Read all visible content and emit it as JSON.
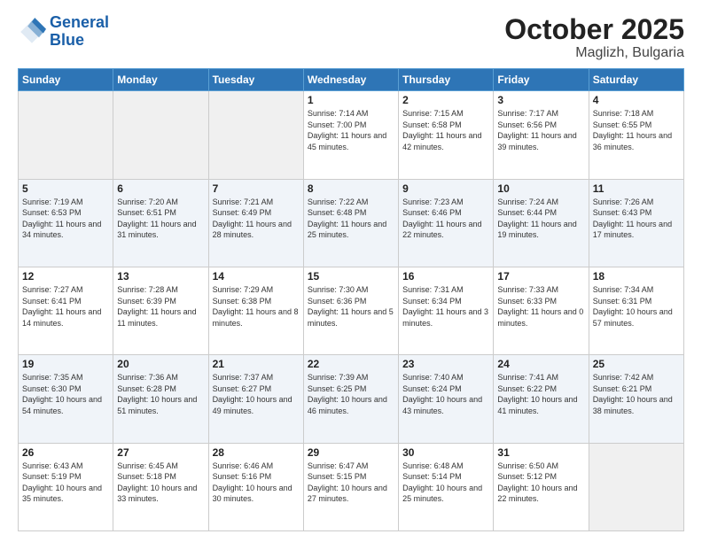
{
  "header": {
    "logo_general": "General",
    "logo_blue": "Blue",
    "month_title": "October 2025",
    "location": "Maglizh, Bulgaria"
  },
  "weekdays": [
    "Sunday",
    "Monday",
    "Tuesday",
    "Wednesday",
    "Thursday",
    "Friday",
    "Saturday"
  ],
  "weeks": [
    [
      {
        "day": "",
        "empty": true
      },
      {
        "day": "",
        "empty": true
      },
      {
        "day": "",
        "empty": true
      },
      {
        "day": "1",
        "sunrise": "7:14 AM",
        "sunset": "7:00 PM",
        "daylight": "11 hours and 45 minutes."
      },
      {
        "day": "2",
        "sunrise": "7:15 AM",
        "sunset": "6:58 PM",
        "daylight": "11 hours and 42 minutes."
      },
      {
        "day": "3",
        "sunrise": "7:17 AM",
        "sunset": "6:56 PM",
        "daylight": "11 hours and 39 minutes."
      },
      {
        "day": "4",
        "sunrise": "7:18 AM",
        "sunset": "6:55 PM",
        "daylight": "11 hours and 36 minutes."
      }
    ],
    [
      {
        "day": "5",
        "sunrise": "7:19 AM",
        "sunset": "6:53 PM",
        "daylight": "11 hours and 34 minutes."
      },
      {
        "day": "6",
        "sunrise": "7:20 AM",
        "sunset": "6:51 PM",
        "daylight": "11 hours and 31 minutes."
      },
      {
        "day": "7",
        "sunrise": "7:21 AM",
        "sunset": "6:49 PM",
        "daylight": "11 hours and 28 minutes."
      },
      {
        "day": "8",
        "sunrise": "7:22 AM",
        "sunset": "6:48 PM",
        "daylight": "11 hours and 25 minutes."
      },
      {
        "day": "9",
        "sunrise": "7:23 AM",
        "sunset": "6:46 PM",
        "daylight": "11 hours and 22 minutes."
      },
      {
        "day": "10",
        "sunrise": "7:24 AM",
        "sunset": "6:44 PM",
        "daylight": "11 hours and 19 minutes."
      },
      {
        "day": "11",
        "sunrise": "7:26 AM",
        "sunset": "6:43 PM",
        "daylight": "11 hours and 17 minutes."
      }
    ],
    [
      {
        "day": "12",
        "sunrise": "7:27 AM",
        "sunset": "6:41 PM",
        "daylight": "11 hours and 14 minutes."
      },
      {
        "day": "13",
        "sunrise": "7:28 AM",
        "sunset": "6:39 PM",
        "daylight": "11 hours and 11 minutes."
      },
      {
        "day": "14",
        "sunrise": "7:29 AM",
        "sunset": "6:38 PM",
        "daylight": "11 hours and 8 minutes."
      },
      {
        "day": "15",
        "sunrise": "7:30 AM",
        "sunset": "6:36 PM",
        "daylight": "11 hours and 5 minutes."
      },
      {
        "day": "16",
        "sunrise": "7:31 AM",
        "sunset": "6:34 PM",
        "daylight": "11 hours and 3 minutes."
      },
      {
        "day": "17",
        "sunrise": "7:33 AM",
        "sunset": "6:33 PM",
        "daylight": "11 hours and 0 minutes."
      },
      {
        "day": "18",
        "sunrise": "7:34 AM",
        "sunset": "6:31 PM",
        "daylight": "10 hours and 57 minutes."
      }
    ],
    [
      {
        "day": "19",
        "sunrise": "7:35 AM",
        "sunset": "6:30 PM",
        "daylight": "10 hours and 54 minutes."
      },
      {
        "day": "20",
        "sunrise": "7:36 AM",
        "sunset": "6:28 PM",
        "daylight": "10 hours and 51 minutes."
      },
      {
        "day": "21",
        "sunrise": "7:37 AM",
        "sunset": "6:27 PM",
        "daylight": "10 hours and 49 minutes."
      },
      {
        "day": "22",
        "sunrise": "7:39 AM",
        "sunset": "6:25 PM",
        "daylight": "10 hours and 46 minutes."
      },
      {
        "day": "23",
        "sunrise": "7:40 AM",
        "sunset": "6:24 PM",
        "daylight": "10 hours and 43 minutes."
      },
      {
        "day": "24",
        "sunrise": "7:41 AM",
        "sunset": "6:22 PM",
        "daylight": "10 hours and 41 minutes."
      },
      {
        "day": "25",
        "sunrise": "7:42 AM",
        "sunset": "6:21 PM",
        "daylight": "10 hours and 38 minutes."
      }
    ],
    [
      {
        "day": "26",
        "sunrise": "6:43 AM",
        "sunset": "5:19 PM",
        "daylight": "10 hours and 35 minutes."
      },
      {
        "day": "27",
        "sunrise": "6:45 AM",
        "sunset": "5:18 PM",
        "daylight": "10 hours and 33 minutes."
      },
      {
        "day": "28",
        "sunrise": "6:46 AM",
        "sunset": "5:16 PM",
        "daylight": "10 hours and 30 minutes."
      },
      {
        "day": "29",
        "sunrise": "6:47 AM",
        "sunset": "5:15 PM",
        "daylight": "10 hours and 27 minutes."
      },
      {
        "day": "30",
        "sunrise": "6:48 AM",
        "sunset": "5:14 PM",
        "daylight": "10 hours and 25 minutes."
      },
      {
        "day": "31",
        "sunrise": "6:50 AM",
        "sunset": "5:12 PM",
        "daylight": "10 hours and 22 minutes."
      },
      {
        "day": "",
        "empty": true
      }
    ]
  ]
}
